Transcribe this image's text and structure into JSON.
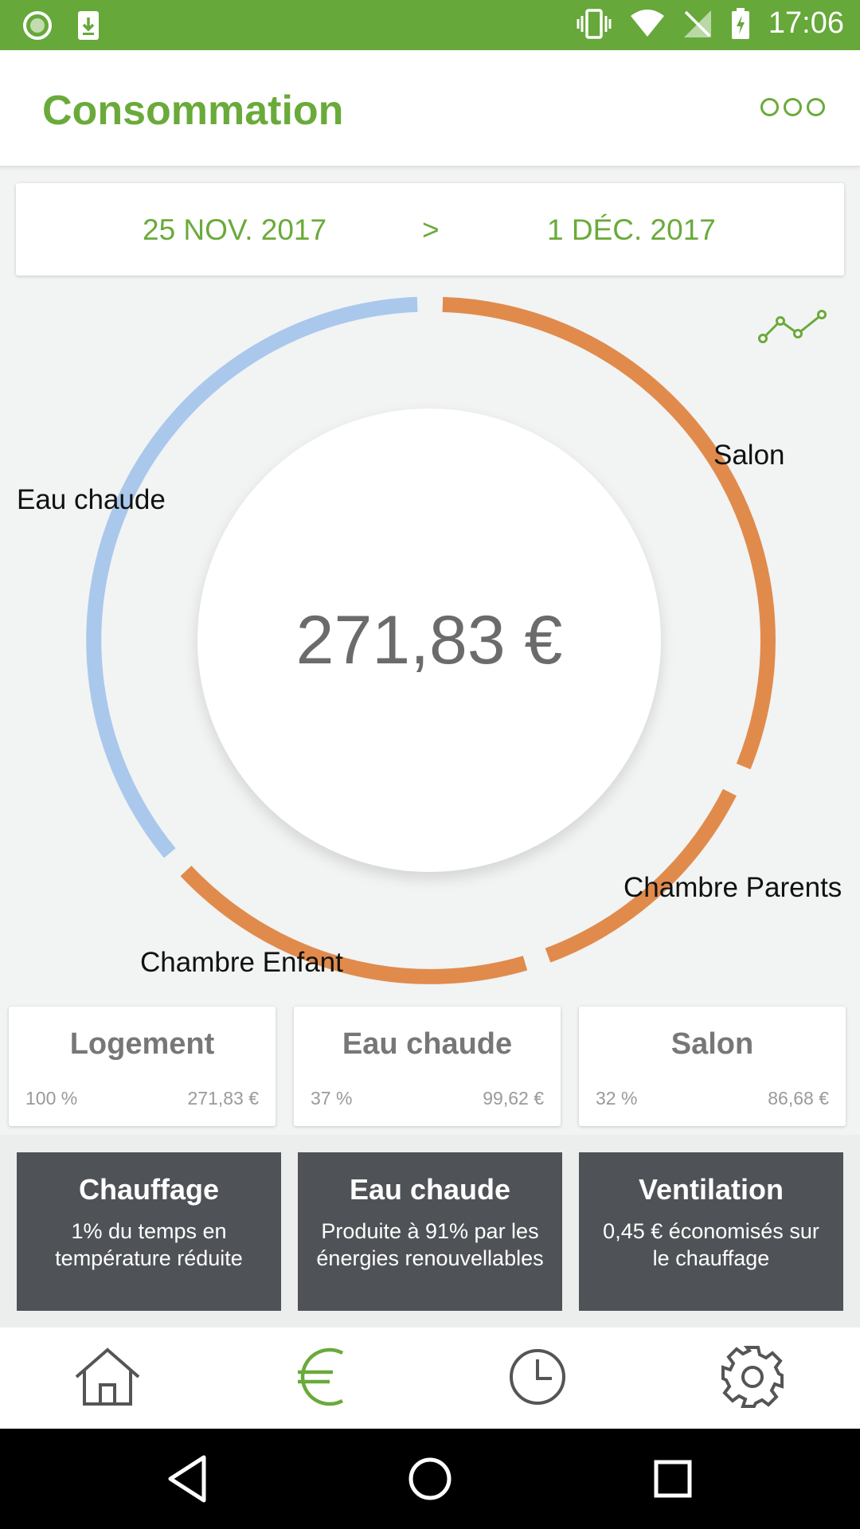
{
  "status_bar": {
    "time": "17:06"
  },
  "header": {
    "title": "Consommation",
    "menu_icon": "more-icon"
  },
  "date_range": {
    "start": "25 NOV. 2017",
    "separator": ">",
    "end": "1 DÉC. 2017"
  },
  "chart": {
    "total": "271,83 €",
    "segments": [
      {
        "label": "Salon",
        "color": "#e08b4c"
      },
      {
        "label": "Chambre Parents",
        "color": "#e08b4c"
      },
      {
        "label": "Chambre Enfant",
        "color": "#e08b4c"
      },
      {
        "label": "Eau chaude",
        "color": "#a9c8ec"
      }
    ]
  },
  "summary_cards": [
    {
      "title": "Logement",
      "percent": "100 %",
      "amount": "271,83 €"
    },
    {
      "title": "Eau chaude",
      "percent": "37 %",
      "amount": "99,62 €"
    },
    {
      "title": "Salon",
      "percent": "32 %",
      "amount": "86,68 €"
    }
  ],
  "info_tiles": [
    {
      "title": "Chauffage",
      "body": "1% du temps en température réduite"
    },
    {
      "title": "Eau chaude",
      "body": "Produite à 91% par les énergies renouvellables"
    },
    {
      "title": "Ventilation",
      "body": "0,45 € économisés sur le chauffage"
    }
  ],
  "bottom_nav": [
    {
      "icon": "home-icon",
      "active": false
    },
    {
      "icon": "euro-icon",
      "active": true
    },
    {
      "icon": "clock-icon",
      "active": false
    },
    {
      "icon": "gear-icon",
      "active": false
    }
  ],
  "colors": {
    "brand_green": "#66a83a",
    "orange": "#e08b4c",
    "blue": "#a9c8ec",
    "tile_gray": "#4f5256"
  }
}
